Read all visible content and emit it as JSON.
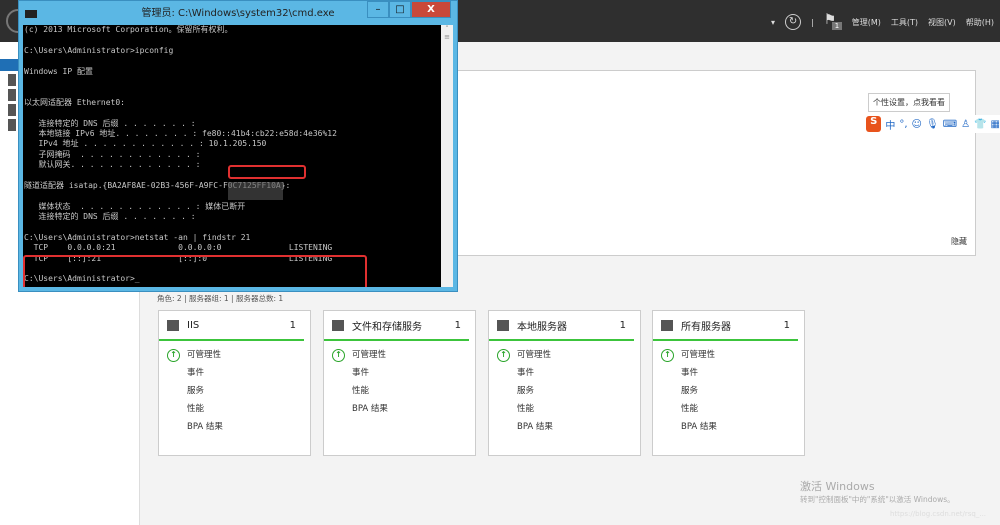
{
  "topbar": {
    "menus": [
      "管理(M)",
      "工具(T)",
      "视图(V)",
      "帮助(H)"
    ],
    "notification_count": "1"
  },
  "welcome": {
    "hide_label": "隐藏"
  },
  "ime": {
    "tooltip": "个性设置，点我看看",
    "logo": "S",
    "mode": "中"
  },
  "summary": "角色: 2 | 服务器组: 1 | 服务器总数: 1",
  "cards": [
    {
      "title": "IIS",
      "count": "1",
      "items": [
        "可管理性",
        "事件",
        "服务",
        "性能",
        "BPA 结果"
      ]
    },
    {
      "title": "文件和存储服务",
      "count": "1",
      "items": [
        "可管理性",
        "事件",
        "性能",
        "BPA 结果"
      ]
    },
    {
      "title": "本地服务器",
      "count": "1",
      "items": [
        "可管理性",
        "事件",
        "服务",
        "性能",
        "BPA 结果"
      ]
    },
    {
      "title": "所有服务器",
      "count": "1",
      "items": [
        "可管理性",
        "事件",
        "服务",
        "性能",
        "BPA 结果"
      ]
    }
  ],
  "activation": {
    "title": "激活 Windows",
    "subtitle": "转到\"控制面板\"中的\"系统\"以激活 Windows。"
  },
  "watermark": "https://blog.csdn.net/rsq_...",
  "cmd": {
    "title": "管理员: C:\\Windows\\system32\\cmd.exe",
    "lines": [
      "(c) 2013 Microsoft Corporation。保留所有权利。",
      "",
      "C:\\Users\\Administrator>ipconfig",
      "",
      "Windows IP 配置",
      "",
      "",
      "以太网适配器 Ethernet0:",
      "",
      "   连接特定的 DNS 后缀 . . . . . . . :",
      "   本地链接 IPv6 地址. . . . . . . . : fe80::41b4:cb22:e58d:4e36%12",
      "   IPv4 地址 . . . . . . . . . . . . : 10.1.205.150",
      "   子网掩码  . . . . . . . . . . . . :",
      "   默认网关. . . . . . . . . . . . . :",
      "",
      "隧道适配器 isatap.{BA2AF8AE-02B3-456F-A9FC-F0C7125FF10A}:",
      "",
      "   媒体状态  . . . . . . . . . . . . : 媒体已断开",
      "   连接特定的 DNS 后缀 . . . . . . . :",
      "",
      "C:\\Users\\Administrator>netstat -an | findstr 21",
      "  TCP    0.0.0.0:21             0.0.0.0:0              LISTENING",
      "  TCP    [::]:21                [::]:0                 LISTENING",
      "",
      "C:\\Users\\Administrator>_"
    ]
  }
}
